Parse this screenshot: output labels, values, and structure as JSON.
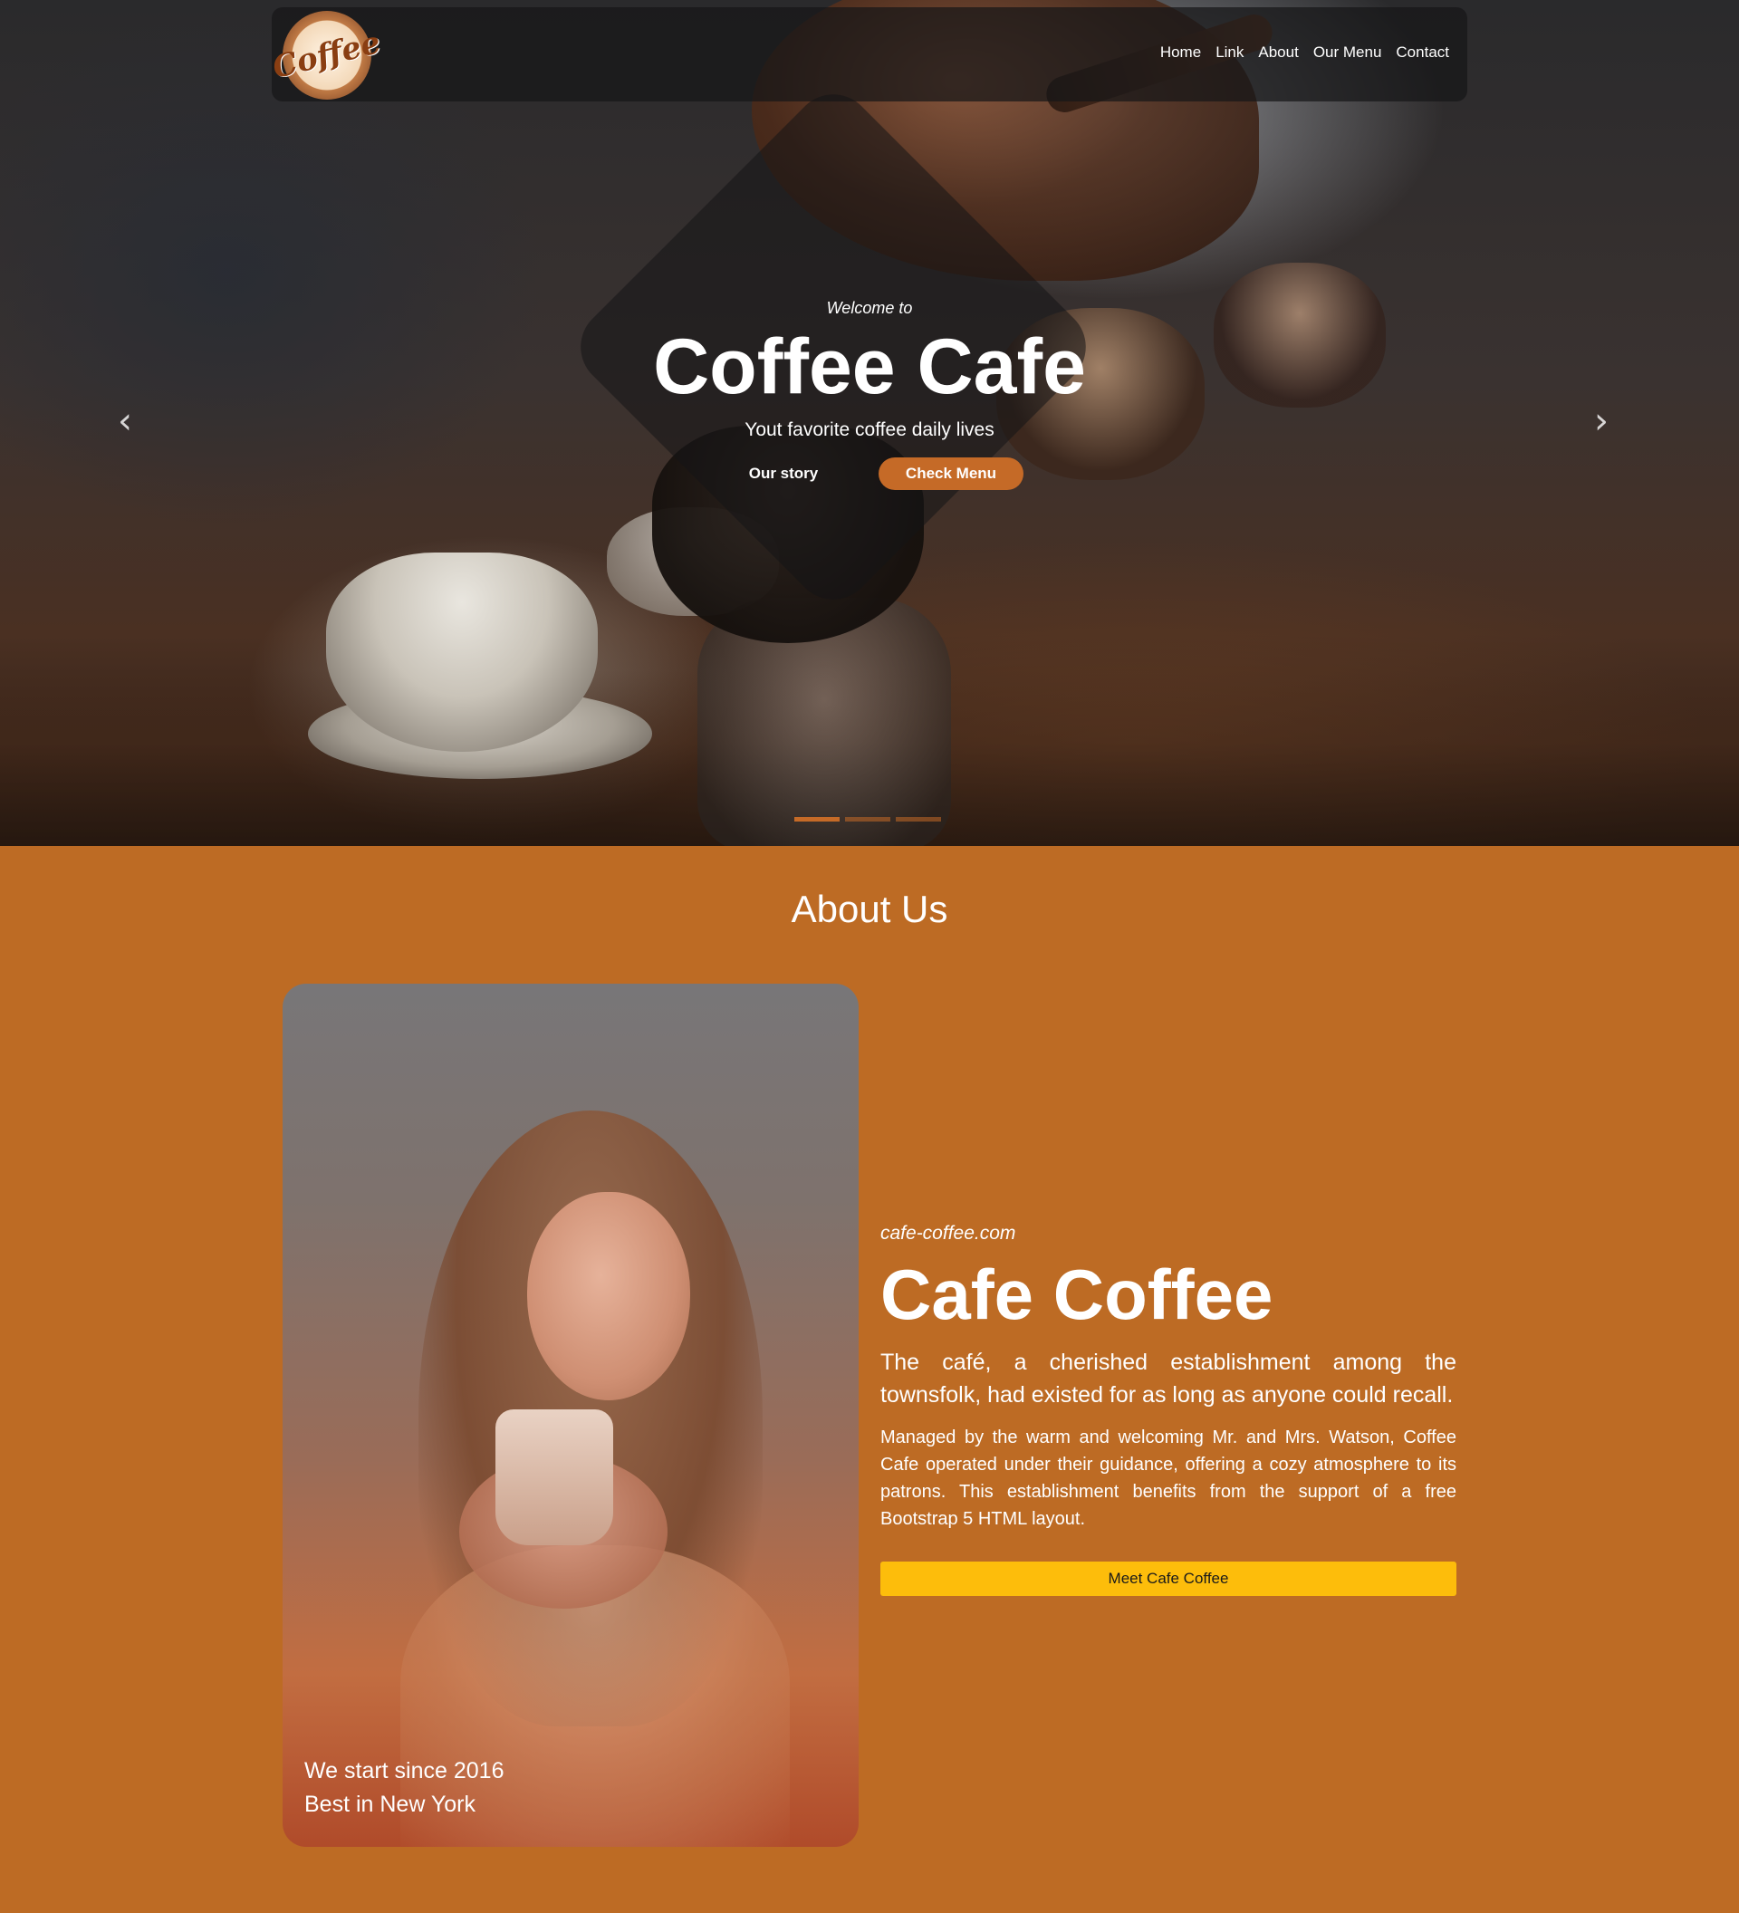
{
  "nav": {
    "logo_text": "Coffee",
    "links": [
      "Home",
      "Link",
      "About",
      "Our Menu",
      "Contact"
    ]
  },
  "hero": {
    "welcome": "Welcome to",
    "title": "Coffee Cafe",
    "subtitle": "Yout favorite coffee daily lives",
    "btn_story": "Our story",
    "btn_menu": "Check Menu",
    "arrow_prev": "‹",
    "arrow_next": "›",
    "indicators": 3,
    "active_indicator": 0
  },
  "about": {
    "title": "About Us",
    "caption_line1": "We start since 2016",
    "caption_line2": "Best in New York",
    "domain": "cafe-coffee.com",
    "heading": "Cafe Coffee",
    "lead": "The café, a cherished establishment among the townsfolk, had existed for as long as anyone could recall.",
    "body": "Managed by the warm and welcoming Mr. and Mrs. Watson, Coffee Cafe operated under their guidance, offering a cozy atmosphere to its patrons. This establishment benefits from the support of a free Bootstrap 5 HTML layout.",
    "button": "Meet Cafe Coffee"
  },
  "colors": {
    "accent": "#c56a27",
    "section_bg": "#bd6b24",
    "button_yellow": "#fdbd0b"
  }
}
